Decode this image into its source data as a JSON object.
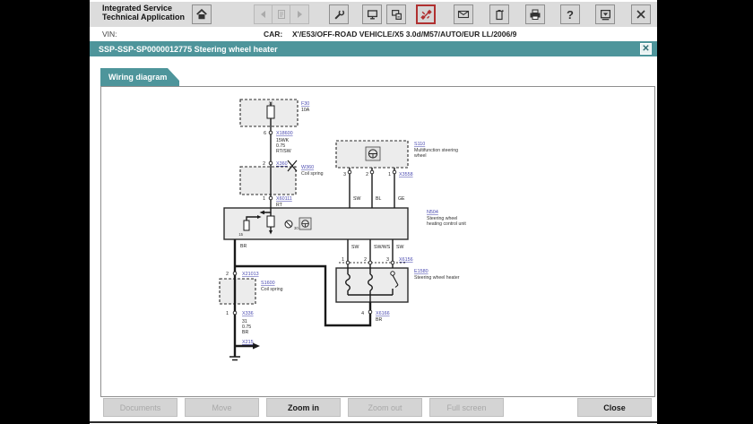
{
  "app": {
    "title": "Integrated Service\nTechnical Application"
  },
  "toolbar": {
    "help_glyph": "?",
    "items": [
      {
        "name": "home",
        "enabled": true
      },
      {
        "name": "back",
        "enabled": false
      },
      {
        "name": "document",
        "enabled": false
      },
      {
        "name": "forward",
        "enabled": false
      },
      {
        "name": "wrench",
        "enabled": true
      },
      {
        "name": "display",
        "enabled": true
      },
      {
        "name": "devices",
        "enabled": true
      },
      {
        "name": "connector",
        "enabled": true,
        "highlight": "#b03030"
      },
      {
        "name": "mail",
        "enabled": true
      },
      {
        "name": "battery",
        "enabled": true
      },
      {
        "name": "printer",
        "enabled": true
      },
      {
        "name": "help",
        "enabled": true
      },
      {
        "name": "minimize",
        "enabled": true
      },
      {
        "name": "close",
        "enabled": true
      }
    ]
  },
  "vin_row": {
    "vin_label": "VIN:",
    "car_label": "CAR:",
    "car_value": "X'/E53/OFF-ROAD VEHICLE/X5 3.0d/M57/AUTO/EUR LL/2006/9"
  },
  "title_bar": {
    "text": "SSP-SSP-SP0000012775 Steering wheel heater",
    "close_glyph": "✕"
  },
  "tab": {
    "label": "Wiring diagram"
  },
  "buttons": {
    "documents": "Documents",
    "move": "Move",
    "zoom_in": "Zoom in",
    "zoom_out": "Zoom out",
    "full_screen": "Full screen",
    "close": "Close"
  },
  "colors": {
    "teal": "#4e959b",
    "link_blue": "#4a4ab0",
    "highlight_red": "#b03030"
  },
  "diagram": {
    "fuse": {
      "terminal": "30",
      "id": "F30",
      "rating": "10A"
    },
    "conn_top": {
      "pin": "6",
      "label": "X18600"
    },
    "wire_top": {
      "l1": "15WK",
      "l2": "0.75",
      "l3": "RT/SW"
    },
    "conn_x360": {
      "pin": "2",
      "label": "X360"
    },
    "coil_top": {
      "id": "W360",
      "name": "Coil spring"
    },
    "conn_x60111": {
      "pin": "1",
      "label": "X60111",
      "wire": "RT"
    },
    "ctrl": {
      "id": "N504",
      "name1": "Steering wheel",
      "name2": "heating control unit",
      "t15": "15",
      "t30": "30"
    },
    "mfw": {
      "id": "S110",
      "name1": "Multifunction steering",
      "name2": "wheel",
      "pin3": "3",
      "pin2": "2",
      "pin1": "1",
      "conn": "X3558",
      "w1": "SW",
      "w2": "BL",
      "w3": "GE"
    },
    "mid": {
      "w1": "SW",
      "w2": "SW/WS",
      "w3": "SW",
      "p1": "1",
      "p2": "2",
      "p3": "3",
      "conn": "X6156"
    },
    "heater": {
      "id": "E1580",
      "name": "Steering wheel heater",
      "pin": "4",
      "conn": "X6166",
      "wire": "BR"
    },
    "gnd": {
      "wire": "BR",
      "pin2": "2",
      "conn2": "X21013",
      "coil_id": "S1600",
      "coil_name": "Coil spring",
      "pin1": "1",
      "conn1": "X336",
      "s1": "31",
      "s2": "0.75",
      "s3": "BR",
      "ref": "X215"
    }
  }
}
